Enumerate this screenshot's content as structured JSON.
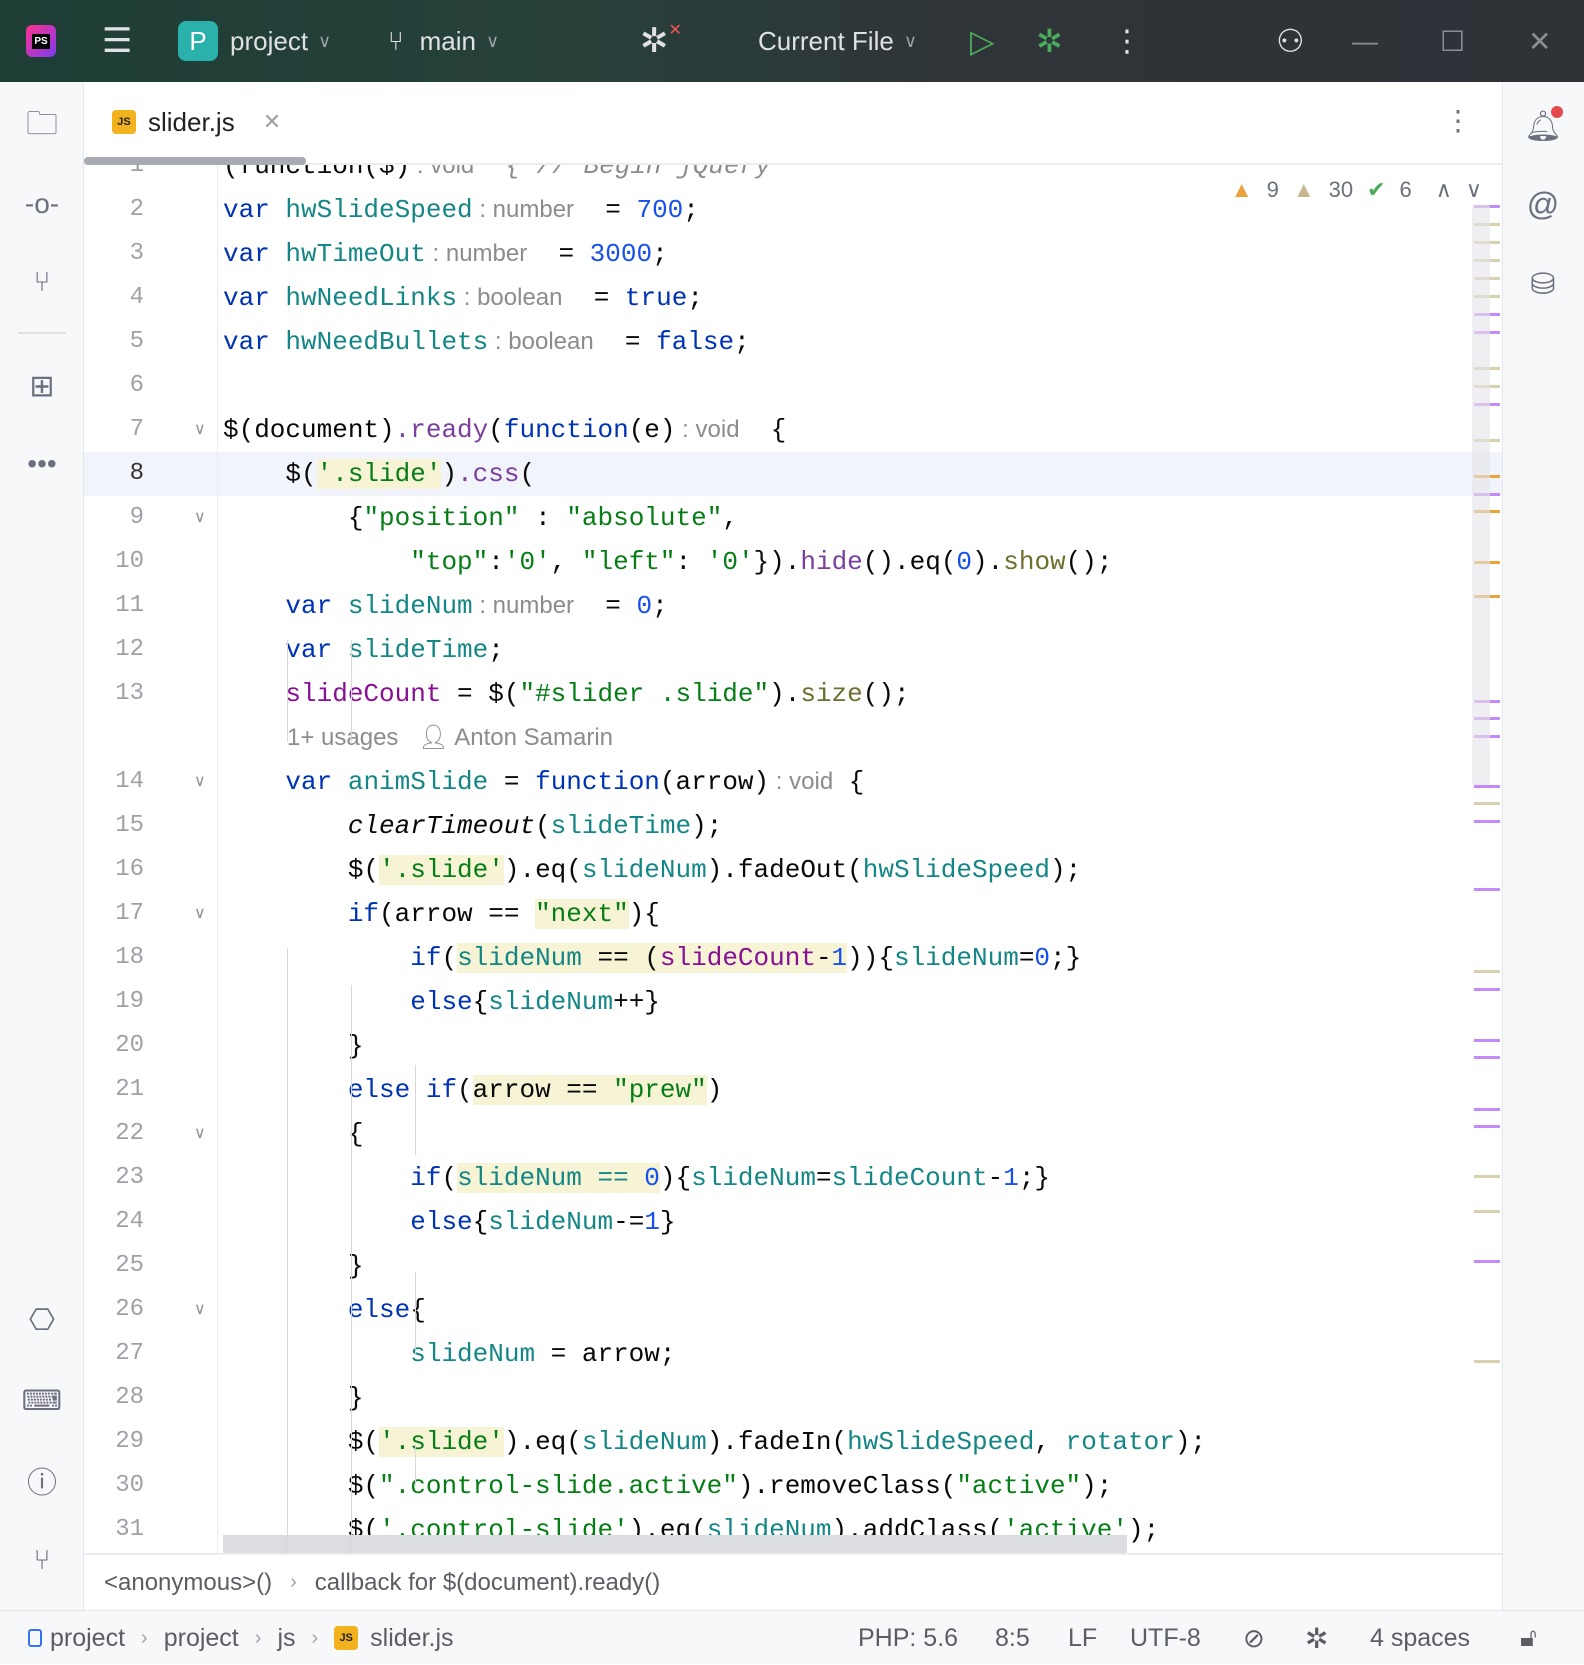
{
  "titlebar": {
    "logo": "PS",
    "project_badge": "P",
    "project": "project",
    "branch": "main",
    "run_config": "Current File"
  },
  "tab": {
    "file": "slider.js",
    "icon": "JS"
  },
  "inspections": {
    "warnings": "9",
    "weak_warnings": "30",
    "ok": "6"
  },
  "colors": {
    "accent": "#2ab1ac",
    "run": "#4aab5b",
    "js_badge": "#f2b21d"
  },
  "code": [
    {
      "n": "1",
      "t": [
        [
          "(function($)",
          "p"
        ],
        [
          " : void",
          "h"
        ],
        [
          "  { // Begin jQuery",
          "c"
        ]
      ]
    },
    {
      "n": "2",
      "t": [
        [
          "var",
          "k"
        ],
        [
          " "
        ],
        [
          "hwSlideSpeed",
          "v"
        ],
        [
          " : number",
          "h"
        ],
        [
          "  = "
        ],
        [
          "700",
          "n"
        ],
        [
          ";"
        ]
      ]
    },
    {
      "n": "3",
      "t": [
        [
          "var",
          "k"
        ],
        [
          " "
        ],
        [
          "hwTimeOut",
          "v"
        ],
        [
          " : number",
          "h"
        ],
        [
          "  = "
        ],
        [
          "3000",
          "n"
        ],
        [
          ";"
        ]
      ]
    },
    {
      "n": "4",
      "t": [
        [
          "var",
          "k"
        ],
        [
          " "
        ],
        [
          "hwNeedLinks",
          "v"
        ],
        [
          " : boolean",
          "h"
        ],
        [
          "  = "
        ],
        [
          "true",
          "k"
        ],
        [
          ";"
        ]
      ]
    },
    {
      "n": "5",
      "t": [
        [
          "var",
          "k"
        ],
        [
          " "
        ],
        [
          "hwNeedBullets",
          "v"
        ],
        [
          " : boolean",
          "h"
        ],
        [
          "  = "
        ],
        [
          "false",
          "k"
        ],
        [
          ";"
        ]
      ]
    },
    {
      "n": "6",
      "t": []
    },
    {
      "n": "7",
      "fold": true,
      "t": [
        [
          "$(document)"
        ],
        [
          ".ready",
          "m"
        ],
        [
          "("
        ],
        [
          "function",
          "k"
        ],
        [
          "(e)"
        ],
        [
          " : void",
          "h"
        ],
        [
          "  {"
        ]
      ]
    },
    {
      "n": "8",
      "cur": true,
      "t": [
        [
          "    $("
        ],
        [
          "'.slide'",
          "s",
          "hl"
        ],
        [
          ")"
        ],
        [
          ".css",
          "m"
        ],
        [
          "("
        ]
      ]
    },
    {
      "n": "9",
      "fold": true,
      "t": [
        [
          "        {"
        ],
        [
          "\"position\"",
          "s"
        ],
        [
          " : "
        ],
        [
          "\"absolute\"",
          "s"
        ],
        [
          ","
        ]
      ]
    },
    {
      "n": "10",
      "t": [
        [
          "            "
        ],
        [
          "\"top\"",
          "s"
        ],
        [
          ":"
        ],
        [
          "'0'",
          "s"
        ],
        [
          ", "
        ],
        [
          "\"left\"",
          "s"
        ],
        [
          ": "
        ],
        [
          "'0'",
          "s"
        ],
        [
          "})."
        ],
        [
          "hide",
          "m"
        ],
        [
          "()."
        ],
        [
          "eq"
        ],
        [
          "("
        ],
        [
          "0",
          "n"
        ],
        [
          ")."
        ],
        [
          "show",
          "f"
        ],
        [
          "();"
        ]
      ]
    },
    {
      "n": "11",
      "t": [
        [
          "    "
        ],
        [
          "var",
          "k"
        ],
        [
          " "
        ],
        [
          "slideNum",
          "v"
        ],
        [
          " : number",
          "h"
        ],
        [
          "  = "
        ],
        [
          "0",
          "n"
        ],
        [
          ";"
        ]
      ]
    },
    {
      "n": "12",
      "t": [
        [
          "    "
        ],
        [
          "var",
          "k"
        ],
        [
          " "
        ],
        [
          "slideTime",
          "v"
        ],
        [
          ";"
        ]
      ]
    },
    {
      "n": "13",
      "t": [
        [
          "    "
        ],
        [
          "slideCount",
          "g"
        ],
        [
          " = $("
        ],
        [
          "\"#slider .slide\"",
          "s"
        ],
        [
          ")."
        ],
        [
          "size",
          "f"
        ],
        [
          "();"
        ]
      ]
    },
    {
      "n": "",
      "meta": true,
      "usages": "1+ usages",
      "author": "Anton Samarin"
    },
    {
      "n": "14",
      "fold": true,
      "t": [
        [
          "    "
        ],
        [
          "var",
          "k"
        ],
        [
          " "
        ],
        [
          "animSlide",
          "v"
        ],
        [
          " = "
        ],
        [
          "function",
          "k"
        ],
        [
          "(arrow)"
        ],
        [
          " : void",
          "h"
        ],
        [
          " {"
        ]
      ]
    },
    {
      "n": "15",
      "t": [
        [
          "        "
        ],
        [
          "clearTimeout",
          "i"
        ],
        [
          "("
        ],
        [
          "slideTime",
          "v"
        ],
        [
          ");"
        ]
      ]
    },
    {
      "n": "16",
      "t": [
        [
          "        $("
        ],
        [
          "'.slide'",
          "s",
          "hl"
        ],
        [
          ").eq("
        ],
        [
          "slideNum",
          "v"
        ],
        [
          ").fadeOut("
        ],
        [
          "hwSlideSpeed",
          "v"
        ],
        [
          ");"
        ]
      ]
    },
    {
      "n": "17",
      "fold": true,
      "t": [
        [
          "        "
        ],
        [
          "if",
          "k"
        ],
        [
          "(arrow == "
        ],
        [
          "\"next\"",
          "s",
          "hl"
        ],
        [
          "){"
        ]
      ]
    },
    {
      "n": "18",
      "t": [
        [
          "            "
        ],
        [
          "if",
          "k"
        ],
        [
          "("
        ],
        [
          "slideNum",
          "v",
          "hl"
        ],
        [
          " == (",
          "p",
          "hl"
        ],
        [
          "slideCount",
          "g",
          "hl"
        ],
        [
          "-",
          "p",
          "hl"
        ],
        [
          "1",
          "n",
          "hl"
        ],
        [
          ")"
        ],
        [
          "){"
        ],
        [
          "slideNum",
          "v"
        ],
        [
          "="
        ],
        [
          "0",
          "n"
        ],
        [
          ";}"
        ]
      ]
    },
    {
      "n": "19",
      "t": [
        [
          "            "
        ],
        [
          "else",
          "k"
        ],
        [
          "{"
        ],
        [
          "slideNum",
          "v"
        ],
        [
          "++}"
        ]
      ]
    },
    {
      "n": "20",
      "t": [
        [
          "        }"
        ]
      ]
    },
    {
      "n": "21",
      "t": [
        [
          "        "
        ],
        [
          "else if",
          "k"
        ],
        [
          "("
        ],
        [
          "arrow == ",
          "p",
          "hl"
        ],
        [
          "\"prew\"",
          "s",
          "hl"
        ],
        [
          ")"
        ]
      ]
    },
    {
      "n": "22",
      "fold": true,
      "t": [
        [
          "        {"
        ]
      ]
    },
    {
      "n": "23",
      "t": [
        [
          "            "
        ],
        [
          "if",
          "k"
        ],
        [
          "("
        ],
        [
          "slideNum == ",
          "v",
          "hl"
        ],
        [
          "0",
          "n",
          "hl"
        ],
        [
          "){"
        ],
        [
          "slideNum",
          "v"
        ],
        [
          "="
        ],
        [
          "slideCount",
          "v"
        ],
        [
          "-"
        ],
        [
          "1",
          "n"
        ],
        [
          ";}"
        ]
      ]
    },
    {
      "n": "24",
      "t": [
        [
          "            "
        ],
        [
          "else",
          "k"
        ],
        [
          "{"
        ],
        [
          "slideNum",
          "v"
        ],
        [
          "-="
        ],
        [
          "1",
          "n"
        ],
        [
          "}"
        ]
      ]
    },
    {
      "n": "25",
      "t": [
        [
          "        }"
        ]
      ]
    },
    {
      "n": "26",
      "fold": true,
      "t": [
        [
          "        "
        ],
        [
          "else",
          "k"
        ],
        [
          "{"
        ]
      ]
    },
    {
      "n": "27",
      "t": [
        [
          "            "
        ],
        [
          "slideNum",
          "v"
        ],
        [
          " = arrow;"
        ]
      ]
    },
    {
      "n": "28",
      "t": [
        [
          "        }"
        ]
      ]
    },
    {
      "n": "29",
      "t": [
        [
          "        $("
        ],
        [
          "'.slide'",
          "s",
          "hl"
        ],
        [
          ").eq("
        ],
        [
          "slideNum",
          "v"
        ],
        [
          ").fadeIn("
        ],
        [
          "hwSlideSpeed",
          "v"
        ],
        [
          ", "
        ],
        [
          "rotator",
          "v"
        ],
        [
          ");"
        ]
      ]
    },
    {
      "n": "30",
      "t": [
        [
          "        $("
        ],
        [
          "\".control-slide.active\"",
          "s"
        ],
        [
          ").removeClass("
        ],
        [
          "\"active\"",
          "s"
        ],
        [
          ");"
        ]
      ]
    },
    {
      "n": "31",
      "t": [
        [
          "        $("
        ],
        [
          "'.control-slide'",
          "s"
        ],
        [
          ").eq("
        ],
        [
          "slideNum",
          "v"
        ],
        [
          ").addClass("
        ],
        [
          "'active'",
          "s"
        ],
        [
          ");"
        ]
      ]
    }
  ],
  "breadcrumb": [
    "<anonymous>()",
    "callback for $(document).ready()"
  ],
  "status": {
    "path": [
      "project",
      "project",
      "js",
      "slider.js"
    ],
    "php": "PHP: 5.6",
    "position": "8:5",
    "line_sep": "LF",
    "encoding": "UTF-8",
    "indent": "4 spaces"
  }
}
